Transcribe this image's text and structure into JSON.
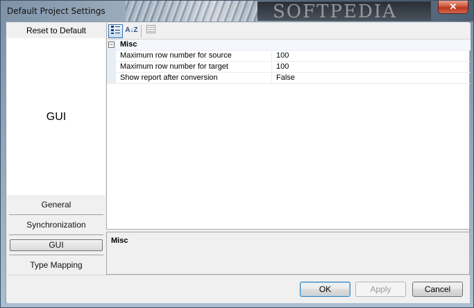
{
  "window": {
    "title": "Default Project Settings",
    "brand_watermark": "SOFTPEDIA",
    "close_glyph": "✕"
  },
  "left_panel": {
    "reset_label": "Reset to Default",
    "current_page_label": "GUI",
    "nav_items": [
      "General",
      "Synchronization",
      "GUI",
      "Type Mapping"
    ],
    "selected_nav": "GUI"
  },
  "toolbar": {
    "categorized_icon": "categorized-icon",
    "alphabetical_icon": "alphabetical-sort-icon",
    "alphabetical_glyph": "A↓Z",
    "property_pages_icon": "property-pages-icon"
  },
  "property_grid": {
    "category": "Misc",
    "expander_glyph": "−",
    "properties": [
      {
        "name": "Maximum row number for source",
        "value": "100"
      },
      {
        "name": "Maximum row number for target",
        "value": "100"
      },
      {
        "name": "Show report after conversion",
        "value": "False"
      }
    ]
  },
  "description": {
    "title": "Misc"
  },
  "footer": {
    "ok_label": "OK",
    "apply_label": "Apply",
    "cancel_label": "Cancel"
  }
}
